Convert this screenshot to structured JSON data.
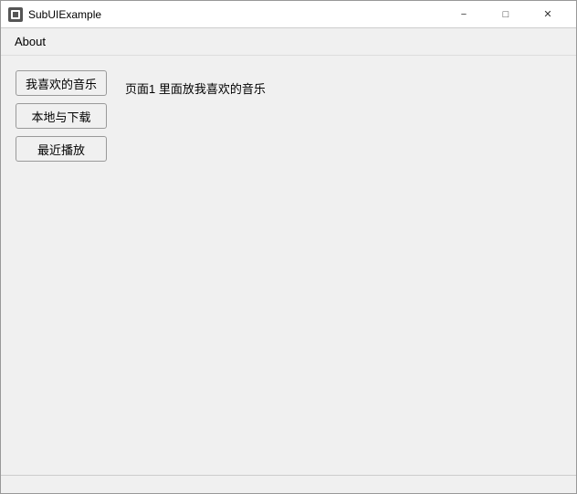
{
  "window": {
    "title": "SubUIExample",
    "icon": "app-icon"
  },
  "titlebar": {
    "minimize_label": "−",
    "maximize_label": "□",
    "close_label": "✕"
  },
  "menu": {
    "about_label": "About"
  },
  "sidebar": {
    "buttons": [
      {
        "id": "favorites",
        "label": "我喜欢的音乐"
      },
      {
        "id": "local",
        "label": "本地与下载"
      },
      {
        "id": "recent",
        "label": "最近播放"
      }
    ]
  },
  "main": {
    "page_text": "页面1 里面放我喜欢的音乐"
  }
}
